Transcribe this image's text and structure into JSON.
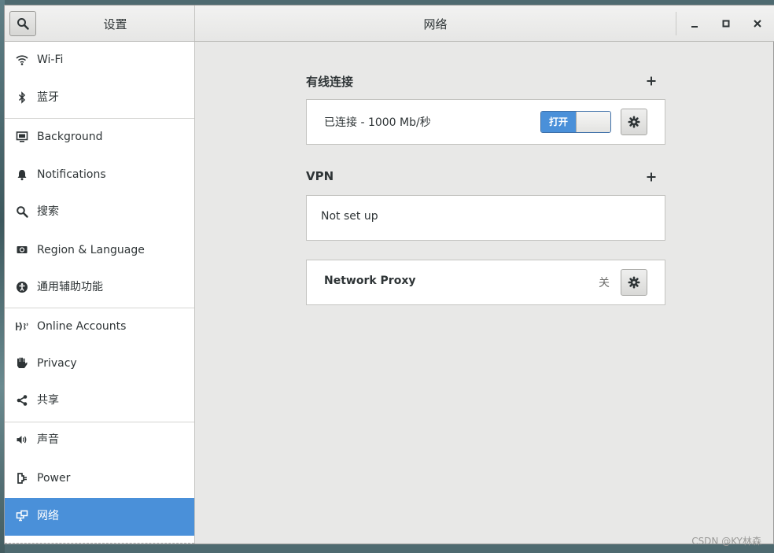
{
  "header": {
    "sidebar_title": "设置",
    "title": "网络"
  },
  "sidebar": {
    "items": [
      {
        "label": "Wi-Fi",
        "icon": "wifi-icon"
      },
      {
        "label": "蓝牙",
        "icon": "bluetooth-icon"
      },
      {
        "label": "Background",
        "icon": "background-icon"
      },
      {
        "label": "Notifications",
        "icon": "bell-icon"
      },
      {
        "label": "搜索",
        "icon": "search-icon"
      },
      {
        "label": "Region & Language",
        "icon": "region-icon"
      },
      {
        "label": "通用辅助功能",
        "icon": "accessibility-icon"
      },
      {
        "label": "Online Accounts",
        "icon": "online-accounts-icon"
      },
      {
        "label": "Privacy",
        "icon": "hand-icon"
      },
      {
        "label": "共享",
        "icon": "share-icon"
      },
      {
        "label": "声音",
        "icon": "speaker-icon"
      },
      {
        "label": "Power",
        "icon": "power-plug-icon"
      },
      {
        "label": "网络",
        "icon": "network-icon",
        "active": true
      }
    ]
  },
  "wired": {
    "section_title": "有线连接",
    "status": "已连接 - 1000 Mb/秒",
    "switch_label": "打开",
    "switch_on": true
  },
  "vpn": {
    "section_title": "VPN",
    "status": "Not set up"
  },
  "proxy": {
    "label": "Network Proxy",
    "state": "关"
  },
  "watermark": "CSDN @KY林森",
  "colors": {
    "accent": "#4a90d9",
    "content_bg": "#e8e8e7",
    "card_bg": "#ffffff"
  }
}
